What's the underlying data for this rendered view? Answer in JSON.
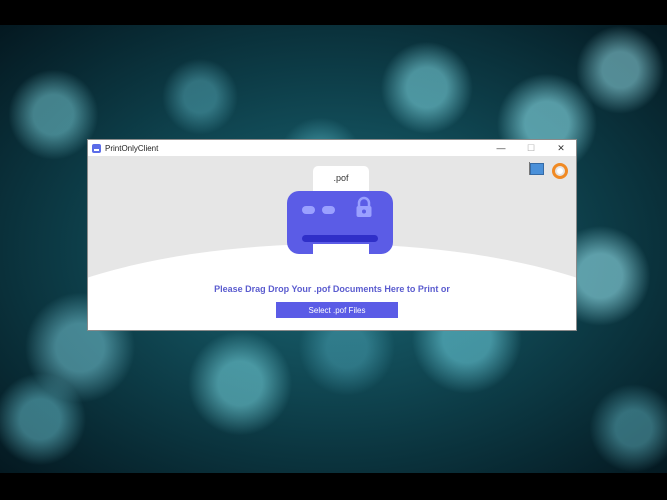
{
  "window": {
    "title": "PrintOnlyClient",
    "controls": {
      "minimize": "—",
      "restore": "☐",
      "close": "✕"
    }
  },
  "illustration": {
    "paper_label": ".pof",
    "icons": [
      "printer-icon",
      "lock-icon"
    ]
  },
  "toolbar_icons": [
    "flag-icon",
    "help-icon"
  ],
  "main": {
    "prompt": "Please Drag  Drop Your .pof Documents Here to Print or",
    "select_button": "Select .pof Files"
  },
  "colors": {
    "accent": "#5b5ce6",
    "prompt_text": "#5b5ccf",
    "printer_slot": "#2f2fc8",
    "background": "#e6e6e6"
  }
}
